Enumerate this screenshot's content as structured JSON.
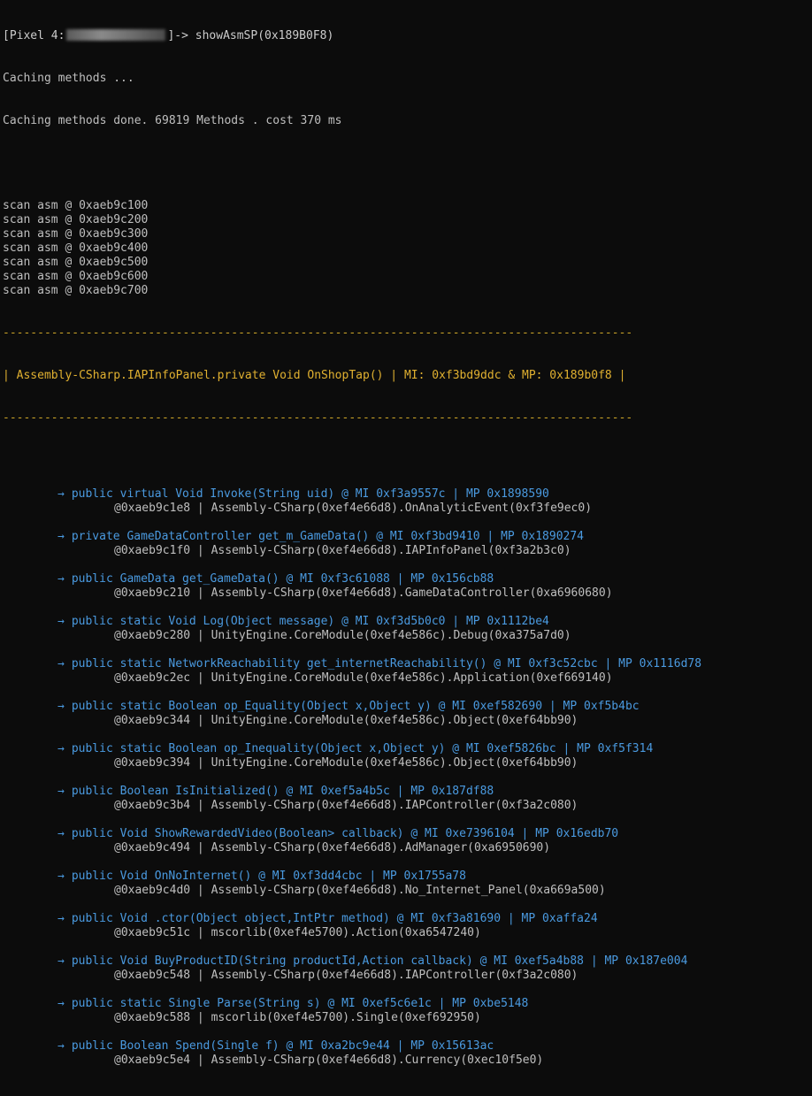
{
  "prompt": {
    "device": "[Pixel 4:",
    "suffix": "]-> showAsmSP(0x189B0F8)"
  },
  "log": {
    "caching": "Caching methods ...",
    "caching_done": "Caching methods done. 69819 Methods . cost 370 ms",
    "scans": [
      "scan asm @ 0xaeb9c100",
      "scan asm @ 0xaeb9c200",
      "scan asm @ 0xaeb9c300",
      "scan asm @ 0xaeb9c400",
      "scan asm @ 0xaeb9c500",
      "scan asm @ 0xaeb9c600",
      "scan asm @ 0xaeb9c700"
    ]
  },
  "header": {
    "divider": "--------------------------------------------------------------------------------------------------------",
    "text": "| Assembly-CSharp.IAPInfoPanel.private Void OnShopTap() | MI: 0xf3bd9ddc & MP: 0x189b0f8 |"
  },
  "entries": [
    {
      "call": "public virtual Void Invoke(String uid) @ MI 0xf3a9557c | MP 0x1898590",
      "addr": "@0xaeb9c1e8 | Assembly-CSharp(0xef4e66d8).OnAnalyticEvent(0xf3fe9ec0)"
    },
    {
      "call": "private GameDataController get_m_GameData() @ MI 0xf3bd9410 | MP 0x1890274",
      "addr": "@0xaeb9c1f0 | Assembly-CSharp(0xef4e66d8).IAPInfoPanel(0xf3a2b3c0)"
    },
    {
      "call": "public GameData get_GameData() @ MI 0xf3c61088 | MP 0x156cb88",
      "addr": "@0xaeb9c210 | Assembly-CSharp(0xef4e66d8).GameDataController(0xa6960680)"
    },
    {
      "call": "public static Void Log(Object message) @ MI 0xf3d5b0c0 | MP 0x1112be4",
      "addr": "@0xaeb9c280 | UnityEngine.CoreModule(0xef4e586c).Debug(0xa375a7d0)"
    },
    {
      "call": "public static NetworkReachability get_internetReachability() @ MI 0xf3c52cbc | MP 0x1116d78",
      "addr": "@0xaeb9c2ec | UnityEngine.CoreModule(0xef4e586c).Application(0xef669140)"
    },
    {
      "call": "public static Boolean op_Equality(Object x,Object y) @ MI 0xef582690 | MP 0xf5b4bc",
      "addr": "@0xaeb9c344 | UnityEngine.CoreModule(0xef4e586c).Object(0xef64bb90)"
    },
    {
      "call": "public static Boolean op_Inequality(Object x,Object y) @ MI 0xef5826bc | MP 0xf5f314",
      "addr": "@0xaeb9c394 | UnityEngine.CoreModule(0xef4e586c).Object(0xef64bb90)"
    },
    {
      "call": "public Boolean IsInitialized() @ MI 0xef5a4b5c | MP 0x187df88",
      "addr": "@0xaeb9c3b4 | Assembly-CSharp(0xef4e66d8).IAPController(0xf3a2c080)"
    },
    {
      "call": "public Void ShowRewardedVideo(Boolean> callback) @ MI 0xe7396104 | MP 0x16edb70",
      "addr": "@0xaeb9c494 | Assembly-CSharp(0xef4e66d8).AdManager(0xa6950690)"
    },
    {
      "call": "public Void OnNoInternet() @ MI 0xf3dd4cbc | MP 0x1755a78",
      "addr": "@0xaeb9c4d0 | Assembly-CSharp(0xef4e66d8).No_Internet_Panel(0xa669a500)"
    },
    {
      "call": "public Void .ctor(Object object,IntPtr method) @ MI 0xf3a81690 | MP 0xaffa24",
      "addr": "@0xaeb9c51c | mscorlib(0xef4e5700).Action(0xa6547240)"
    },
    {
      "call": "public Void BuyProductID(String productId,Action callback) @ MI 0xef5a4b88 | MP 0x187e004",
      "addr": "@0xaeb9c548 | Assembly-CSharp(0xef4e66d8).IAPController(0xf3a2c080)"
    },
    {
      "call": "public static Single Parse(String s) @ MI 0xef5c6e1c | MP 0xbe5148",
      "addr": "@0xaeb9c588 | mscorlib(0xef4e5700).Single(0xef692950)"
    },
    {
      "call": "public Boolean Spend(Single f) @ MI 0xa2bc9e44 | MP 0x15613ac",
      "addr": "@0xaeb9c5e4 | Assembly-CSharp(0xef4e66d8).Currency(0xec10f5e0)"
    }
  ],
  "icons": {
    "arrow": "→"
  },
  "colors": {
    "background": "#0c0c0c",
    "text": "#bfbfbf",
    "header": "#e0b030",
    "call": "#4a9ae0"
  }
}
